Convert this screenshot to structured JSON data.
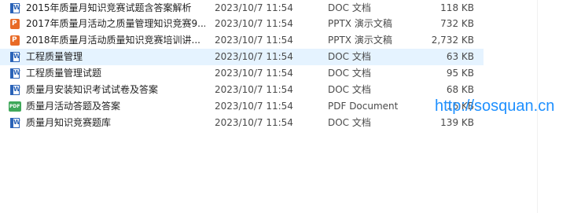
{
  "files": [
    {
      "name": "2015年质量月知识竞赛试题含答案解析",
      "date": "2023/10/7 11:54",
      "type": "DOC 文档",
      "size": "118 KB",
      "icon": "word-doc-icon"
    },
    {
      "name": "2017年质量月活动之质量管理知识竞赛9...",
      "date": "2023/10/7 11:54",
      "type": "PPTX 演示文稿",
      "size": "732 KB",
      "icon": "powerpoint-icon"
    },
    {
      "name": "2018年质量月活动质量知识竞赛培训讲...",
      "date": "2023/10/7 11:54",
      "type": "PPTX 演示文稿",
      "size": "2,732 KB",
      "icon": "powerpoint-icon"
    },
    {
      "name": "工程质量管理",
      "date": "2023/10/7 11:54",
      "type": "DOC 文档",
      "size": "63 KB",
      "icon": "word-doc-icon"
    },
    {
      "name": "工程质量管理试题",
      "date": "2023/10/7 11:54",
      "type": "DOC 文档",
      "size": "95 KB",
      "icon": "word-doc-icon"
    },
    {
      "name": "质量月安装知识考试试卷及答案",
      "date": "2023/10/7 11:54",
      "type": "DOC 文档",
      "size": "68 KB",
      "icon": "word-doc-icon"
    },
    {
      "name": "质量月活动答题及答案",
      "date": "2023/10/7 11:54",
      "type": "PDF Document",
      "size": "16 KB",
      "icon": "pdf-icon"
    },
    {
      "name": "质量月知识竞赛题库",
      "date": "2023/10/7 11:54",
      "type": "DOC 文档",
      "size": "139 KB",
      "icon": "word-doc-icon"
    }
  ],
  "watermark": "http://sosquan.cn",
  "colors": {
    "hover_row": "#e5f3ff",
    "watermark": "#1e90ff"
  }
}
